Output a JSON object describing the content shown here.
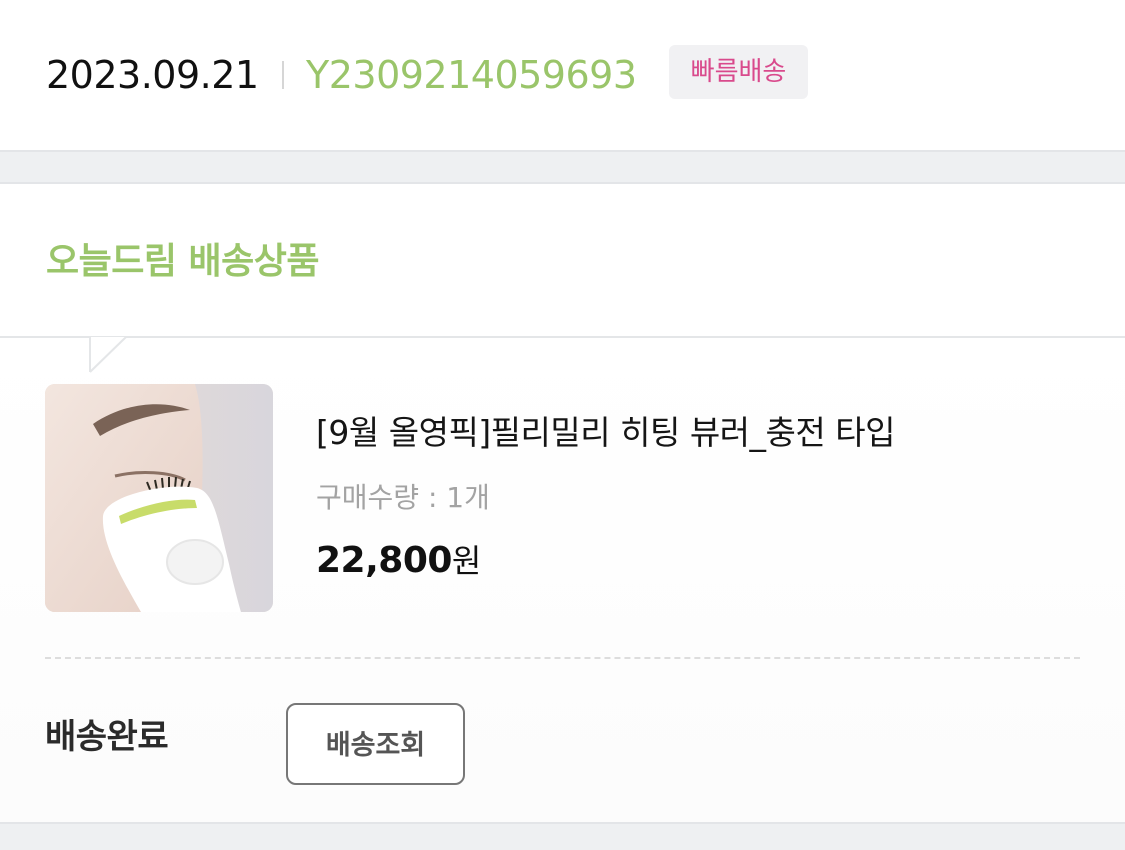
{
  "order": {
    "date": "2023.09.21",
    "number": "Y2309214059693",
    "badge": "빠름배송"
  },
  "section": {
    "title": "오늘드림 배송상품"
  },
  "product": {
    "image_icon": "eyelash-curler-product-photo",
    "name": "[9월 올영픽]필리밀리 히팅 뷰러_충전 타입",
    "quantity_label": "구매수량 : 1개",
    "price": "22,800",
    "currency": "원"
  },
  "delivery": {
    "status": "배송완료",
    "track_button_label": "배송조회"
  },
  "colors": {
    "accent_green": "#9ac56a",
    "badge_pink": "#d94a8c",
    "badge_bg": "#f1f1f3",
    "divider_band": "#eef0f2"
  }
}
